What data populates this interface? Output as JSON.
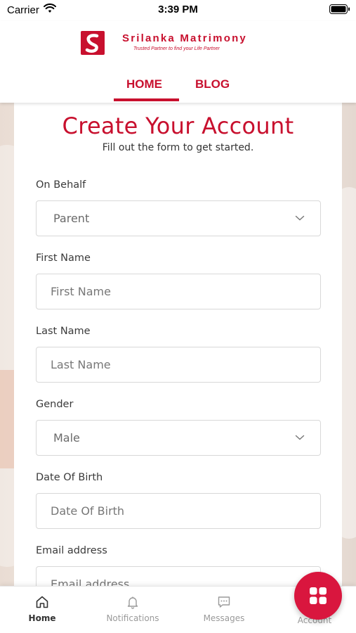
{
  "status_bar": {
    "carrier": "Carrier",
    "time": "3:39 PM"
  },
  "header": {
    "logo_title": "Srilanka Matrimony",
    "logo_tagline": "Trusted Partner to find your Life Partner",
    "tabs": [
      {
        "label": "HOME",
        "active": true
      },
      {
        "label": "BLOG",
        "active": false
      }
    ]
  },
  "form": {
    "title": "Create Your Account",
    "subtitle": "Fill out the form to get started.",
    "fields": {
      "on_behalf": {
        "label": "On Behalf",
        "value": "Parent"
      },
      "first_name": {
        "label": "First Name",
        "placeholder": "First Name"
      },
      "last_name": {
        "label": "Last Name",
        "placeholder": "Last Name"
      },
      "gender": {
        "label": "Gender",
        "value": "Male"
      },
      "dob": {
        "label": "Date Of Birth",
        "placeholder": "Date Of Birth"
      },
      "email": {
        "label": "Email address",
        "placeholder": "Email address"
      }
    }
  },
  "bottom_nav": {
    "home": "Home",
    "notifications": "Notifications",
    "messages": "Messages",
    "account": "Account"
  },
  "colors": {
    "brand": "#c8102e",
    "fab": "#d9163e"
  },
  "icons": [
    "wifi-icon",
    "battery-icon",
    "logo-icon",
    "chevron-down-icon",
    "home-icon",
    "bell-icon",
    "message-icon",
    "grid-icon"
  ]
}
